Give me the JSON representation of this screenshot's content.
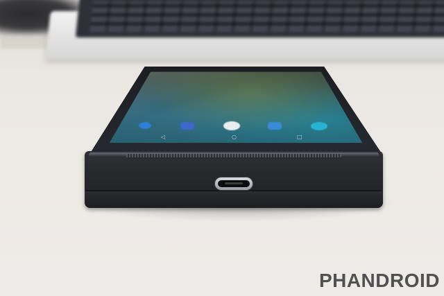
{
  "watermark": {
    "text": "PHANDROID"
  },
  "colors": {
    "background": "#ece9e4",
    "phone_body": "#26282c",
    "usb_port": "#b8bbc0",
    "watermark": "#2f3033"
  },
  "dock_icons": [
    {
      "name": "phone-icon",
      "color": "#2f7fd6"
    },
    {
      "name": "messages-icon",
      "color": "#3d68c9"
    },
    {
      "name": "app-drawer-icon",
      "color": "#e8eef0"
    },
    {
      "name": "contacts-icon",
      "color": "#3a8ad8"
    },
    {
      "name": "chrome-icon",
      "color": "#27b3d2"
    }
  ],
  "nav_buttons": [
    "back-icon",
    "home-icon",
    "recents-icon"
  ]
}
